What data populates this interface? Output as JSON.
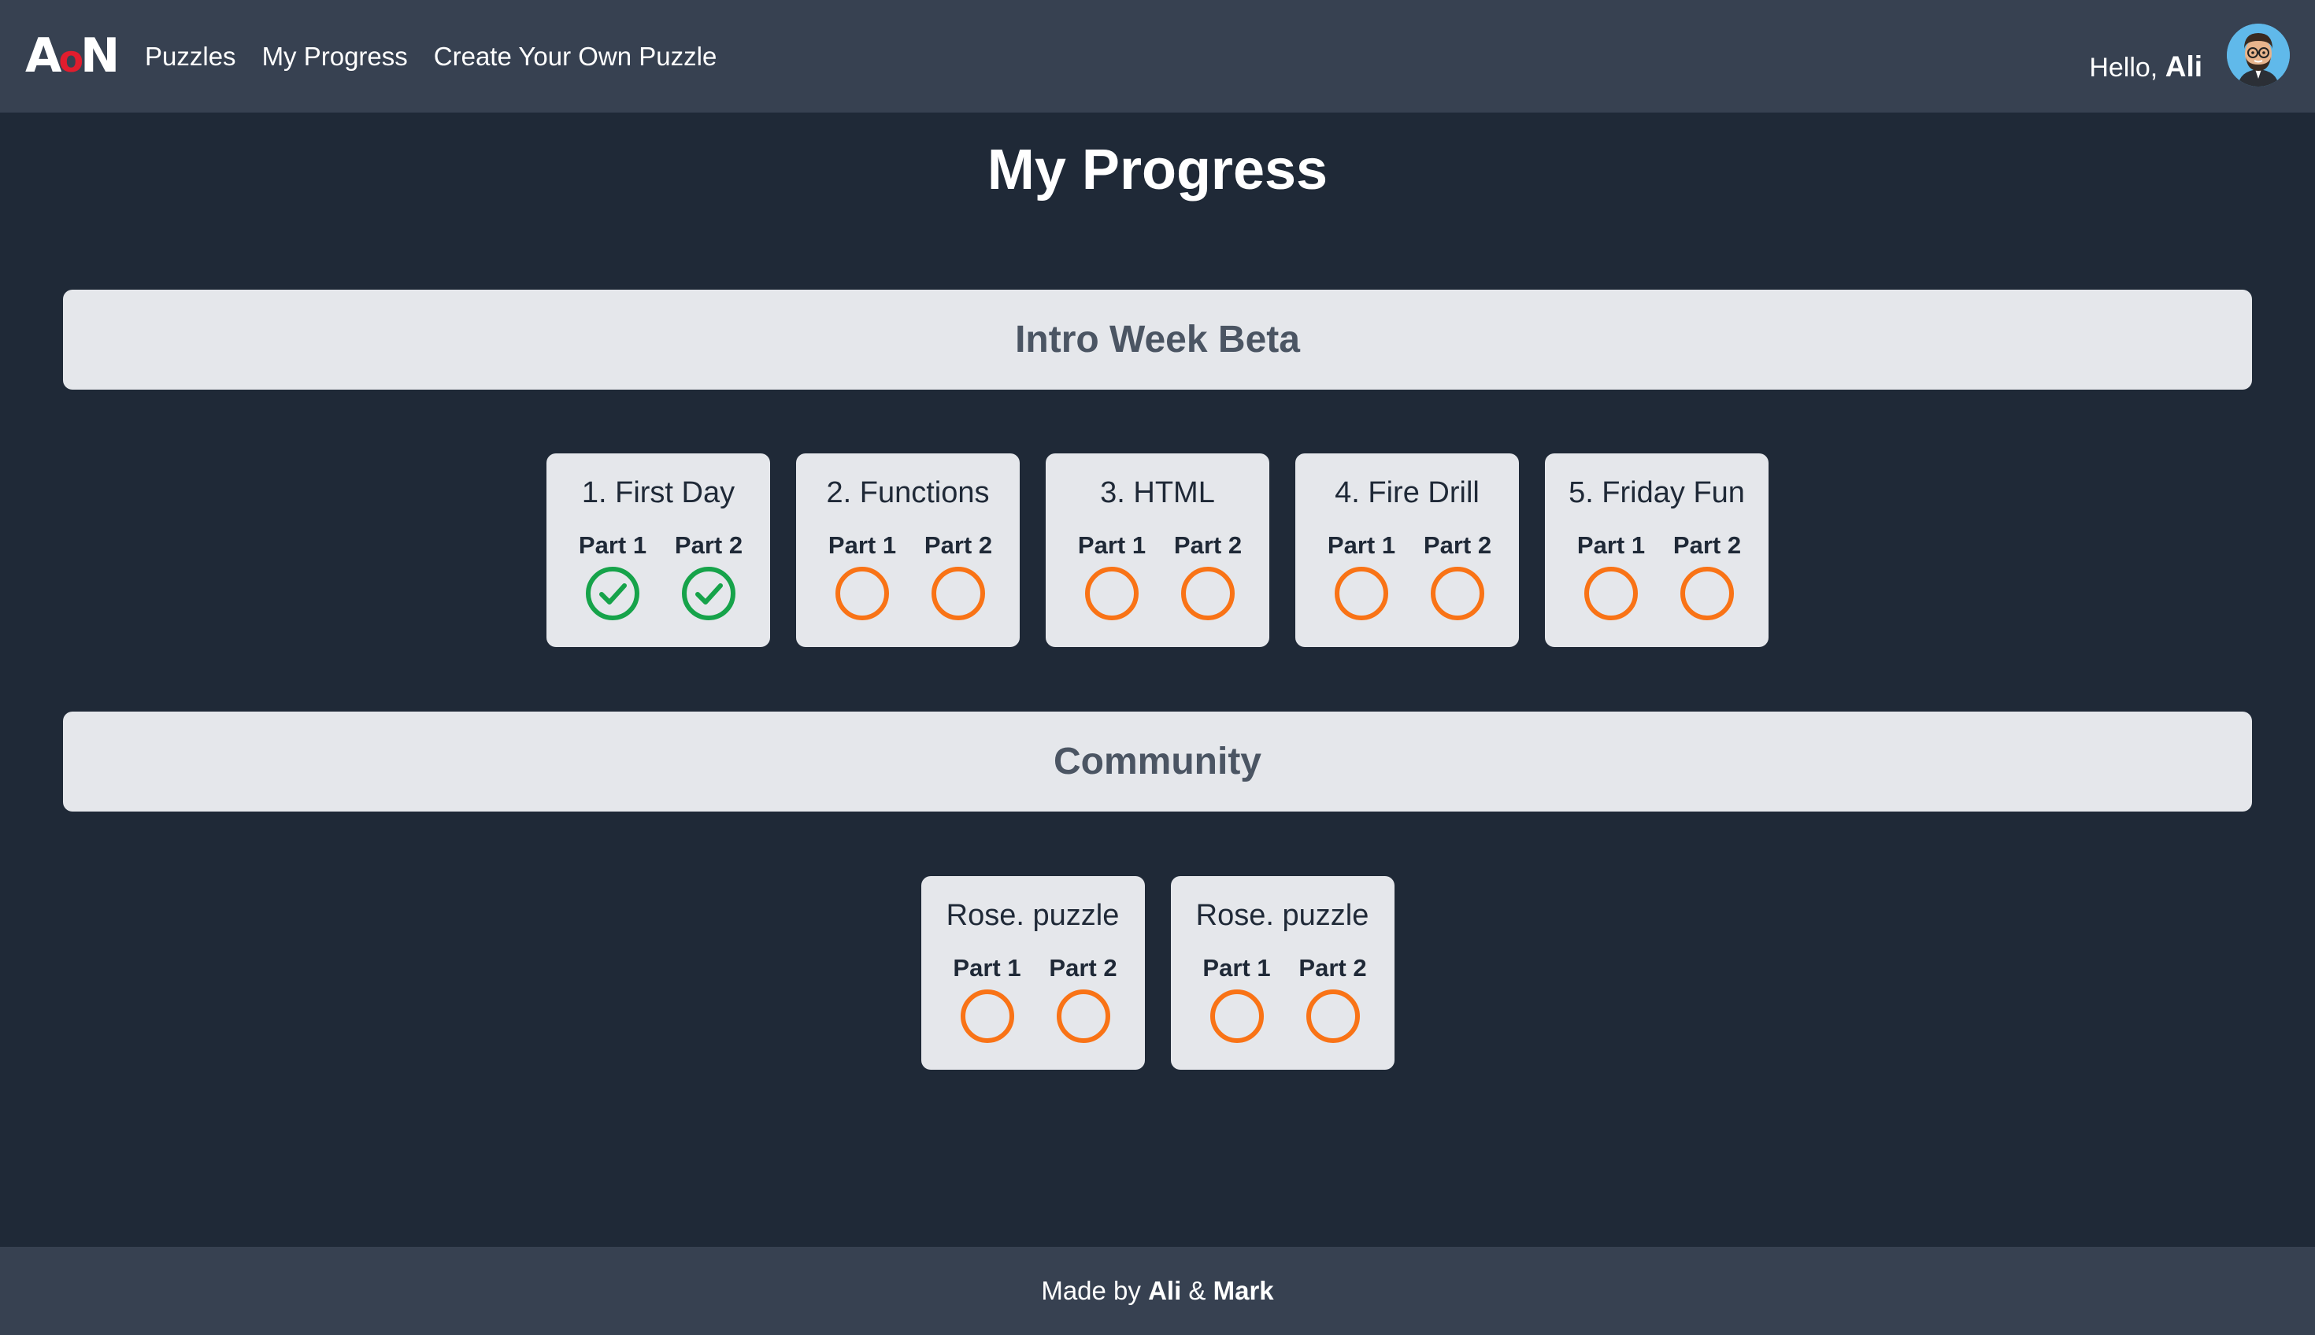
{
  "header": {
    "logo": {
      "left": "A",
      "middle": "o",
      "right": "N"
    },
    "nav": [
      "Puzzles",
      "My Progress",
      "Create Your Own Puzzle"
    ],
    "greeting_prefix": "Hello,",
    "user_name": "Ali"
  },
  "page_title": "My Progress",
  "sections": [
    {
      "title": "Intro Week Beta",
      "puzzles": [
        {
          "title": "1. First Day",
          "parts": [
            {
              "label": "Part 1",
              "status": "complete"
            },
            {
              "label": "Part 2",
              "status": "complete"
            }
          ]
        },
        {
          "title": "2. Functions",
          "parts": [
            {
              "label": "Part 1",
              "status": "incomplete"
            },
            {
              "label": "Part 2",
              "status": "incomplete"
            }
          ]
        },
        {
          "title": "3. HTML",
          "parts": [
            {
              "label": "Part 1",
              "status": "incomplete"
            },
            {
              "label": "Part 2",
              "status": "incomplete"
            }
          ]
        },
        {
          "title": "4. Fire Drill",
          "parts": [
            {
              "label": "Part 1",
              "status": "incomplete"
            },
            {
              "label": "Part 2",
              "status": "incomplete"
            }
          ]
        },
        {
          "title": "5. Friday Fun",
          "parts": [
            {
              "label": "Part 1",
              "status": "incomplete"
            },
            {
              "label": "Part 2",
              "status": "incomplete"
            }
          ]
        }
      ]
    },
    {
      "title": "Community",
      "puzzles": [
        {
          "title": "Rose. puzzle",
          "parts": [
            {
              "label": "Part 1",
              "status": "incomplete"
            },
            {
              "label": "Part 2",
              "status": "incomplete"
            }
          ]
        },
        {
          "title": "Rose. puzzle",
          "parts": [
            {
              "label": "Part 1",
              "status": "incomplete"
            },
            {
              "label": "Part 2",
              "status": "incomplete"
            }
          ]
        }
      ]
    }
  ],
  "footer": {
    "prefix": "Made by",
    "author1": "Ali",
    "joiner": "&",
    "author2": "Mark"
  },
  "colors": {
    "background": "#1f2937",
    "navbar": "#374151",
    "card": "#e5e7eb",
    "complete": "#16a34a",
    "incomplete": "#f97316",
    "logo_accent": "#e11d2e"
  },
  "icons": {
    "complete": "check-circle-icon",
    "incomplete": "empty-circle-icon",
    "avatar": "user-avatar"
  }
}
